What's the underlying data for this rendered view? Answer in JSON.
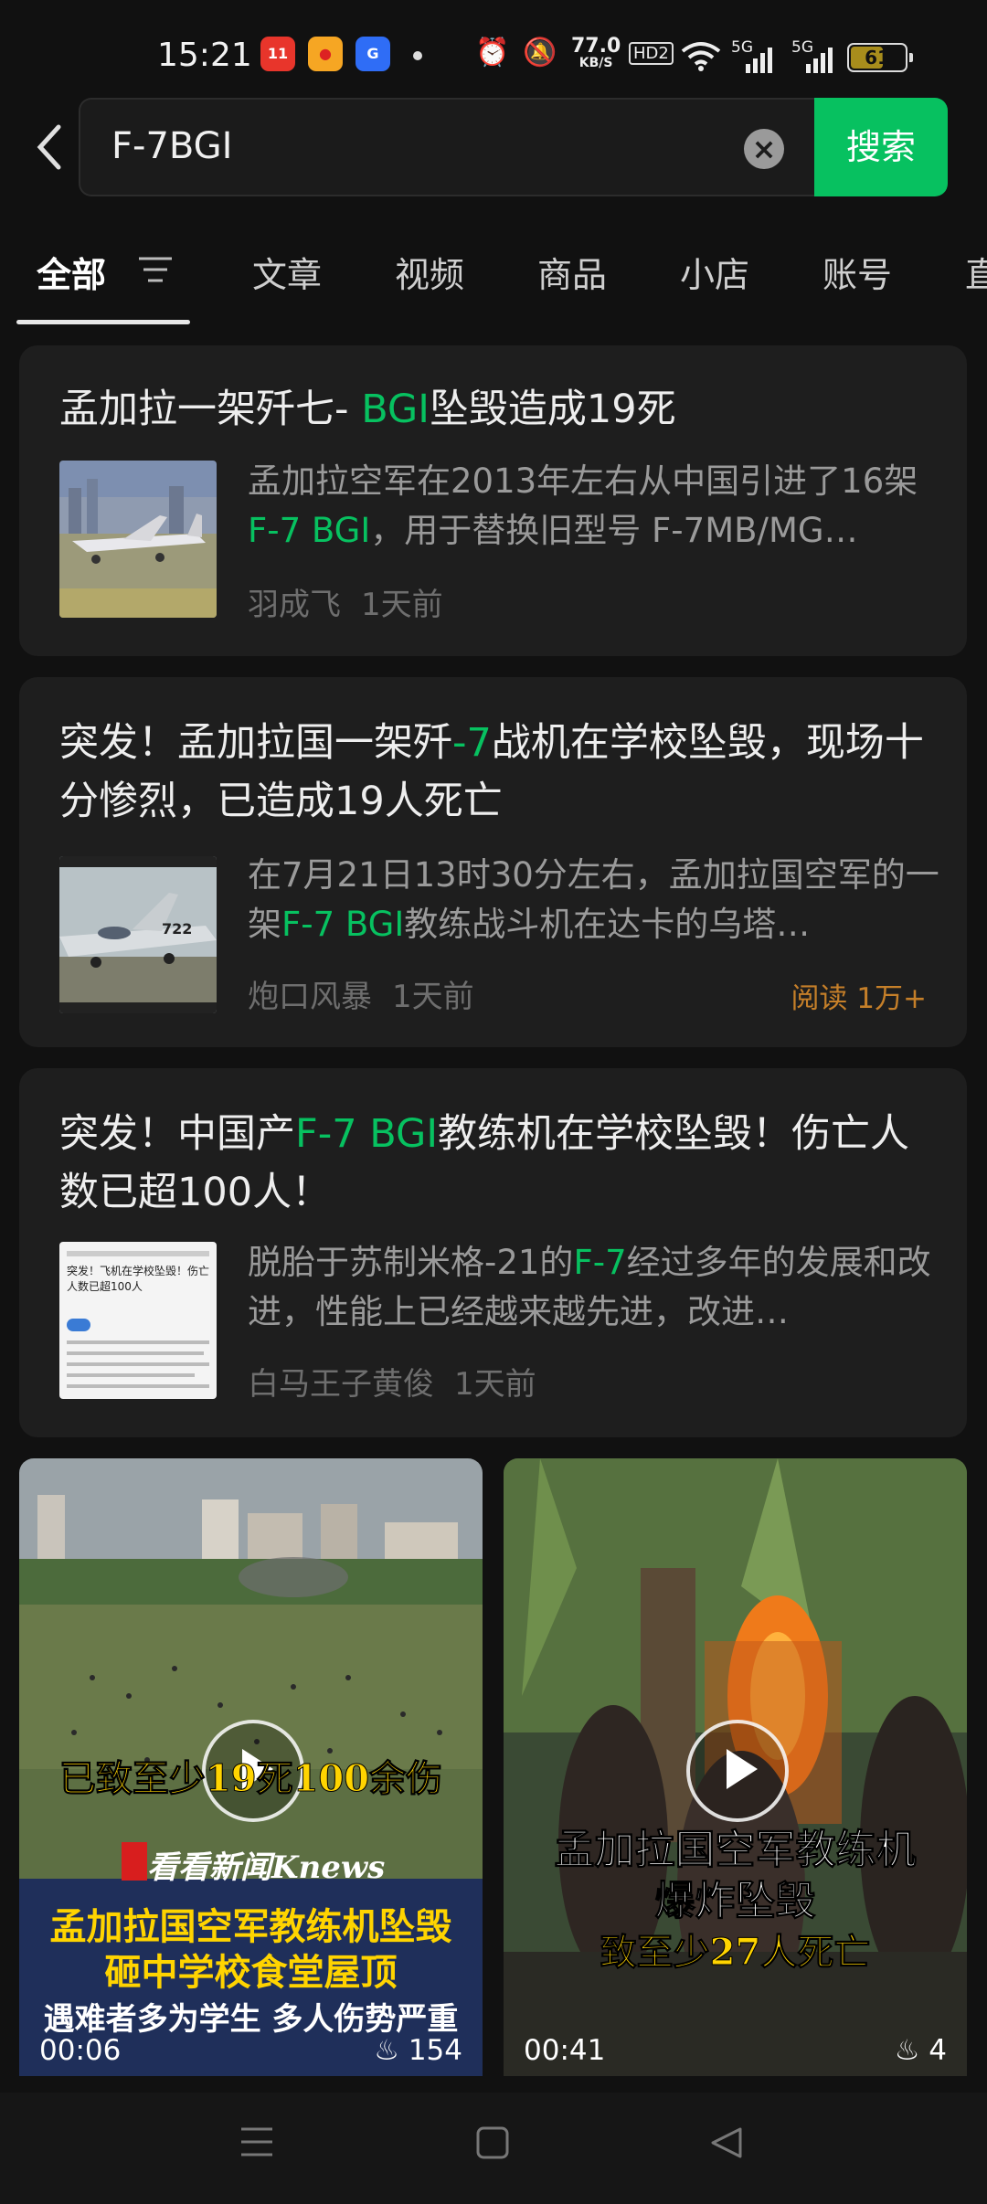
{
  "status": {
    "time": "15:21",
    "app_badges": [
      "11.11",
      "weibo",
      "G"
    ],
    "net_speed": "77.0",
    "net_unit": "KB/S",
    "hd": "HD2",
    "sig1": "5G",
    "sig2": "5G",
    "battery": "61",
    "battery_level": 0.61
  },
  "search": {
    "query": "F-7BGI",
    "button": "搜索"
  },
  "tabs": [
    "全部",
    "文章",
    "视频",
    "商品",
    "小店",
    "账号",
    "直"
  ],
  "results": [
    {
      "title_parts": [
        "孟加拉一架歼七- ",
        "BGI",
        "坠毁造成19死"
      ],
      "snippet_parts": [
        "孟加拉空军在2013年左右从中国引进了16架 ",
        "F-7 BGI",
        "，用于替换旧型号 F-7MB/MG…"
      ],
      "source": "羽成飞",
      "time": "1天前"
    },
    {
      "title_parts": [
        "突发！孟加拉国一架歼",
        "-7",
        "战机在学校坠毁，现场十分惨烈，已造成19人死亡"
      ],
      "snippet_parts": [
        "在7月21日13时30分左右，孟加拉国空军的一架",
        "F-7 BGI",
        "教练战斗机在达卡的乌塔…"
      ],
      "source": "炮口风暴",
      "time": "1天前",
      "reads": "阅读 1万+",
      "thumb_text": "722"
    },
    {
      "title_parts": [
        "突发！中国产",
        "F-7 BGI",
        "教练机在学校坠毁！伤亡人数已超100人！"
      ],
      "snippet_parts": [
        "脱胎于苏制米格-21的",
        "F-7",
        "经过多年的发展和改进，性能上已经越来越先进，改进…"
      ],
      "source": "白马王子黄俊",
      "time": "1天前",
      "thumb_text": "突发！飞机在学校坠毁！伤亡人数已超100人"
    }
  ],
  "videos": [
    {
      "overlay_top": "已致至少19死100余伤",
      "brand": "看看新闻Knews",
      "caption_1": "孟加拉国空军教练机坠毁",
      "caption_2": "砸中学校食堂屋顶",
      "caption_3": "遇难者多为学生 多人伤势严重",
      "duration": "00:06",
      "likes": "154"
    },
    {
      "caption_1": "孟加拉国空军教练机",
      "caption_2": "爆炸坠毁",
      "caption_3": "致至少27人死亡",
      "duration": "00:41",
      "likes": "4"
    }
  ],
  "colors": {
    "accent": "#07c160",
    "reads": "#c57f29",
    "card": "#1e1e1e",
    "background": "#111111"
  },
  "icons": [
    "back-arrow-icon",
    "clear-icon",
    "filter-icon",
    "play-icon",
    "flame-icon",
    "menu-icon",
    "home-square-icon",
    "back-triangle-icon"
  ]
}
